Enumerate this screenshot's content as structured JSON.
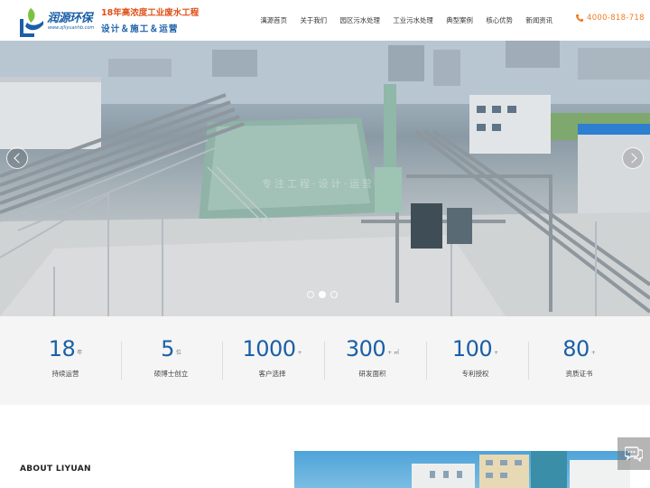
{
  "header": {
    "logo_name": "润源环保",
    "logo_url": "www.zjliyuanhb.com",
    "slogan_line1": "18年高浓度工业废水工程",
    "slogan_line2": "设计＆施工＆运营",
    "phone": "4000-818-718"
  },
  "nav": {
    "items": [
      "漓源首页",
      "关于我们",
      "园区污水处理",
      "工业污水处理",
      "典型案例",
      "核心优势",
      "新闻资讯"
    ]
  },
  "hero": {
    "watermark": "专注工程·设计·运营",
    "slide_count": 3,
    "active_slide": 2
  },
  "stats": [
    {
      "value": "18",
      "unit": "年",
      "label": "持续运营"
    },
    {
      "value": "5",
      "unit": "位",
      "label": "硕博士创立"
    },
    {
      "value": "1000",
      "unit": "+",
      "label": "客户选择"
    },
    {
      "value": "300",
      "unit": "+ ㎡",
      "label": "研发面积"
    },
    {
      "value": "100",
      "unit": "+",
      "label": "专利授权"
    },
    {
      "value": "80",
      "unit": "+",
      "label": "资质证书"
    }
  ],
  "about": {
    "title": "ABOUT LIYUAN"
  },
  "colors": {
    "brand_blue": "#1a5fa8",
    "accent_orange": "#f07a1e",
    "stats_bg": "#f5f5f5"
  }
}
